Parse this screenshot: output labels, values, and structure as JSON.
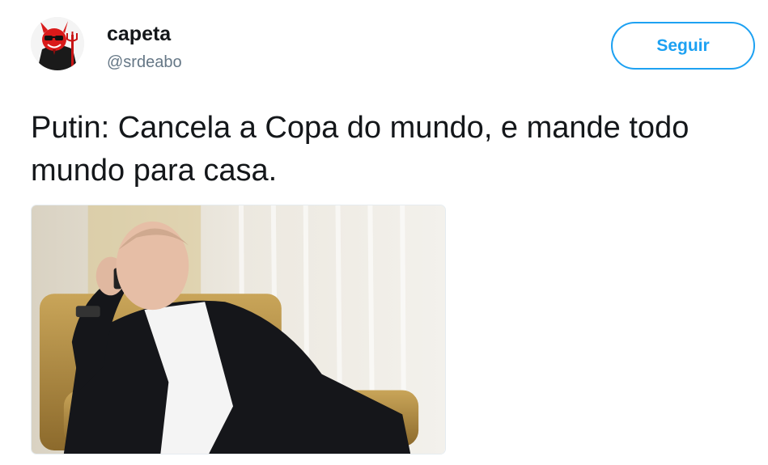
{
  "tweet": {
    "user": {
      "display_name": "capeta",
      "handle": "@srdeabo",
      "avatar_icon": "devil-avatar-icon"
    },
    "follow_label": "Seguir",
    "text": "Putin: Cancela a Copa do mundo, e mande todo mundo para casa.",
    "media_alt": "photo"
  },
  "colors": {
    "accent": "#1da1f2",
    "text_primary": "#14171a",
    "text_secondary": "#657786"
  }
}
